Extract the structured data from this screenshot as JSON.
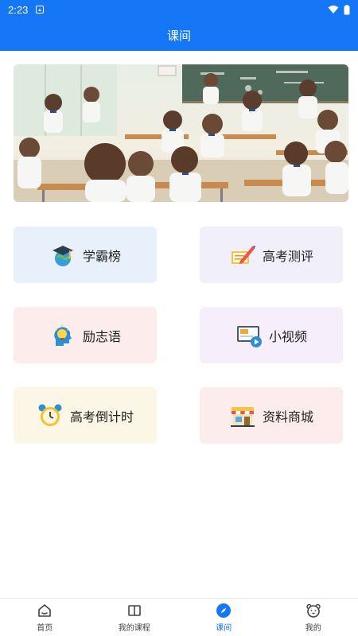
{
  "status_bar": {
    "time": "2:23"
  },
  "app_bar": {
    "title": "课间"
  },
  "cards": [
    {
      "label": "学霸榜",
      "icon": "graduation-globe-icon"
    },
    {
      "label": "高考测评",
      "icon": "pencil-notebook-icon"
    },
    {
      "label": "励志语",
      "icon": "lightbulb-head-icon"
    },
    {
      "label": "小视频",
      "icon": "video-play-icon"
    },
    {
      "label": "高考倒计时",
      "icon": "alarm-clock-icon"
    },
    {
      "label": "资料商城",
      "icon": "shop-icon"
    }
  ],
  "tabs": [
    {
      "label": "首页",
      "icon": "home-icon"
    },
    {
      "label": "我的课程",
      "icon": "book-icon"
    },
    {
      "label": "课间",
      "icon": "compass-icon",
      "active": true
    },
    {
      "label": "我的",
      "icon": "bear-face-icon"
    }
  ],
  "colors": {
    "primary": "#1677f6"
  }
}
